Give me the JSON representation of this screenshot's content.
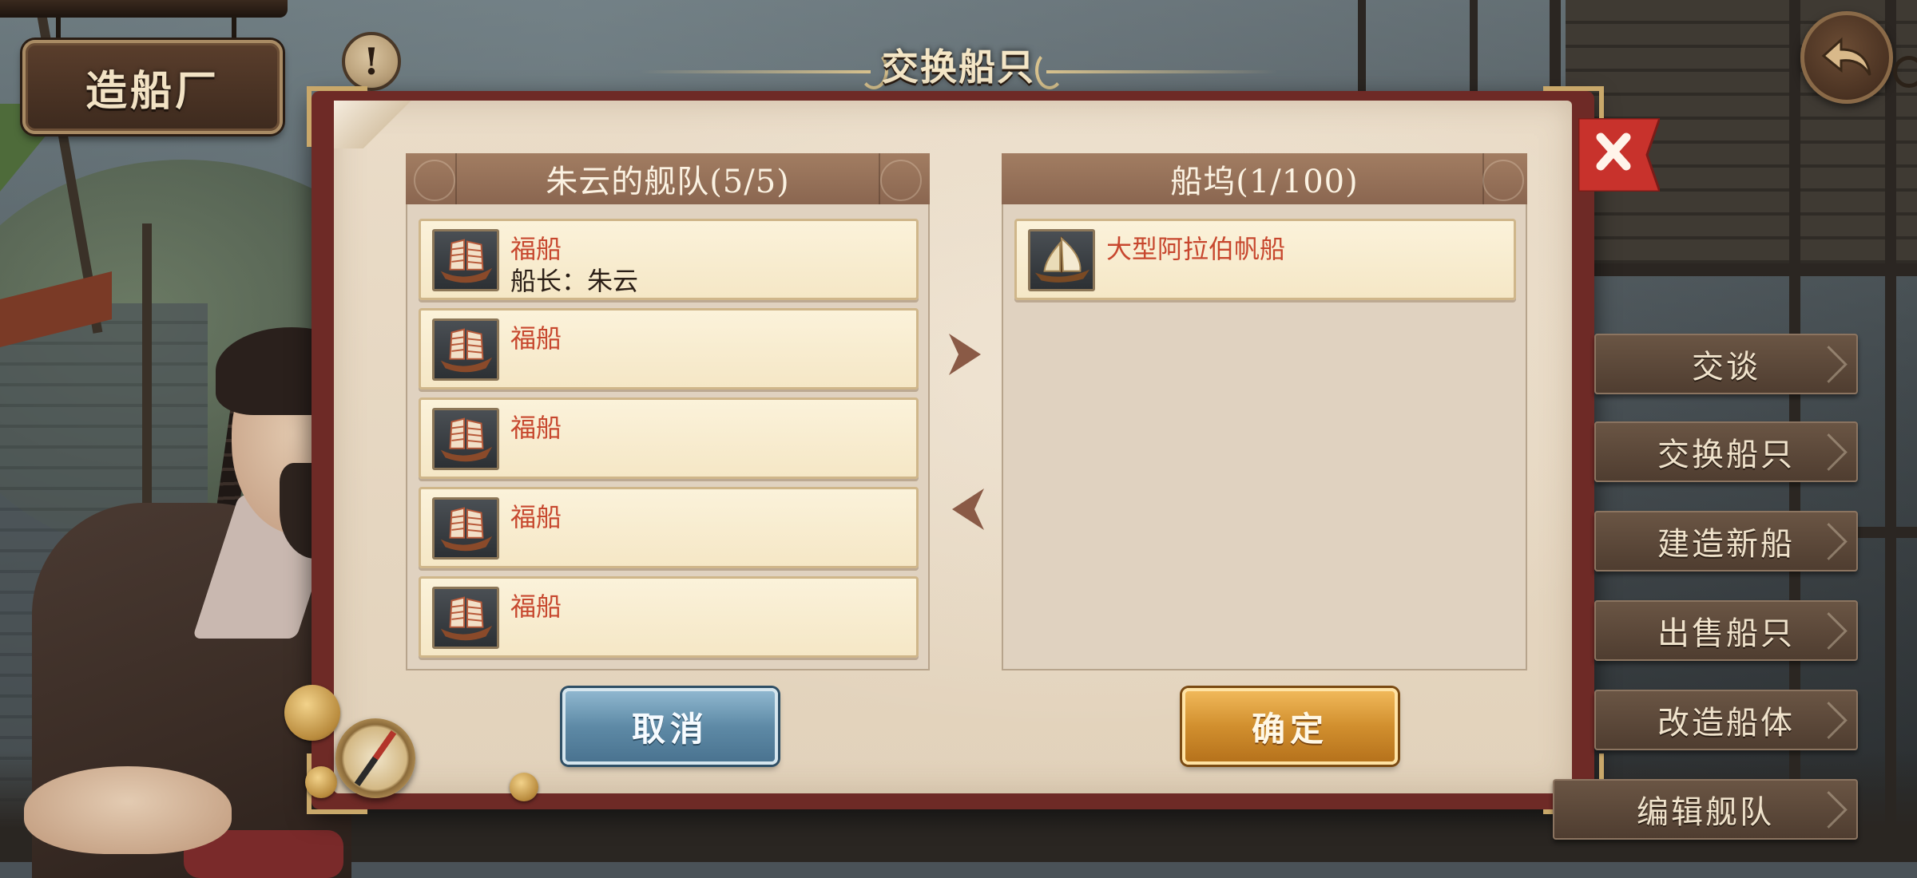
{
  "screen": {
    "location_sign": "造船厂",
    "dialog_title": "交换船只"
  },
  "fleet_panel": {
    "title": "朱云的舰队(5/5)",
    "ships": [
      {
        "name": "福船",
        "captain": "船长：朱云",
        "icon": "junk-ship-icon"
      },
      {
        "name": "福船",
        "captain": "",
        "icon": "junk-ship-icon"
      },
      {
        "name": "福船",
        "captain": "",
        "icon": "junk-ship-icon"
      },
      {
        "name": "福船",
        "captain": "",
        "icon": "junk-ship-icon"
      },
      {
        "name": "福船",
        "captain": "",
        "icon": "junk-ship-icon"
      }
    ]
  },
  "dock_panel": {
    "title": "船坞(1/100)",
    "ships": [
      {
        "name": "大型阿拉伯帆船",
        "icon": "dhow-ship-icon"
      }
    ]
  },
  "buttons": {
    "cancel": "取消",
    "confirm": "确定"
  },
  "side_menu": [
    "交谈",
    "交换船只",
    "建造新船",
    "出售船只",
    "改造船体",
    "编辑舰队"
  ],
  "colors": {
    "ship_name": "#c7472e",
    "panel_header": "#8a6650",
    "dialog_frame": "#6e2a26",
    "cancel_button": "#5e8aa6",
    "confirm_button": "#d18f2e",
    "close_button": "#c8322c"
  }
}
